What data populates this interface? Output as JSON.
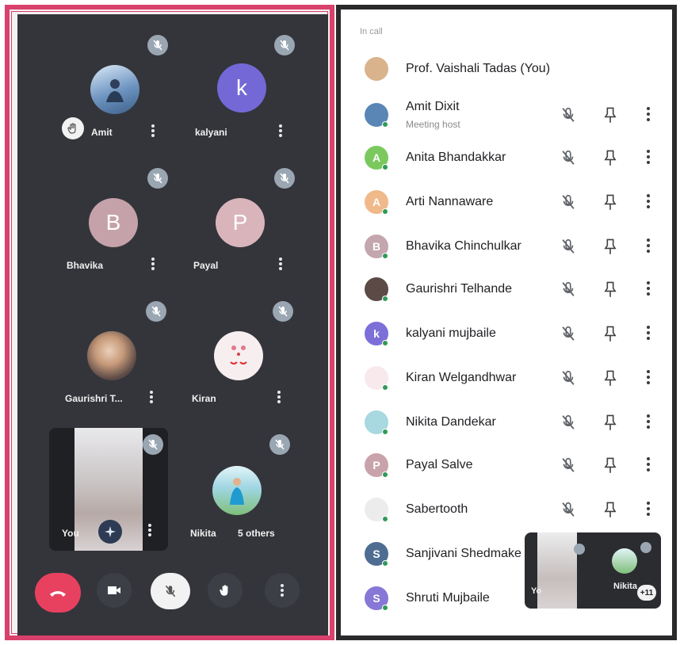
{
  "left_grid": {
    "tiles": [
      {
        "name": "Amit"
      },
      {
        "name": "kalyani",
        "initial": "k"
      },
      {
        "name": "Bhavika",
        "initial": "B"
      },
      {
        "name": "Payal",
        "initial": "P"
      },
      {
        "name": "Gaurishri T..."
      },
      {
        "name": "Kiran"
      },
      {
        "name": "Nikita"
      }
    ],
    "self_label": "You",
    "others_label": "5 others"
  },
  "controls": [
    "end-call",
    "camera",
    "microphone",
    "raise-hand",
    "more-options"
  ],
  "people": {
    "section_label": "In call",
    "rows": [
      {
        "name": "Prof. Vaishali Tadas (You)",
        "avatar_color": "#d9b38c"
      },
      {
        "name": "Amit Dixit",
        "sub": "Meeting host",
        "avatar_color": "#5a86b5"
      },
      {
        "name": "Anita Bhandakkar",
        "initial": "A",
        "avatar_color": "#7bc95e"
      },
      {
        "name": "Arti Nannaware",
        "initial": "A",
        "avatar_color": "#f0b98a"
      },
      {
        "name": "Bhavika Chinchulkar",
        "initial": "B",
        "avatar_color": "#c4a6ae"
      },
      {
        "name": "Gaurishri Telhande",
        "avatar_color": "#5b4a46"
      },
      {
        "name": "kalyani mujbaile",
        "initial": "k",
        "avatar_color": "#7c6fd8"
      },
      {
        "name": "Kiran Welgandhwar",
        "avatar_color": "#f7e9ec"
      },
      {
        "name": "Nikita Dandekar",
        "avatar_color": "#a8d8e0"
      },
      {
        "name": "Payal Salve",
        "initial": "P",
        "avatar_color": "#c9a3ab"
      },
      {
        "name": "Sabertooth",
        "avatar_color": "#ececec"
      },
      {
        "name": "Sanjivani Shedmake",
        "initial": "S",
        "avatar_color": "#4f6d92"
      },
      {
        "name": "Shruti Mujbaile",
        "initial": "S",
        "avatar_color": "#8777d6"
      }
    ]
  },
  "mini_pip": {
    "self_label": "Yo",
    "name": "Nikita",
    "badge": "+11"
  },
  "colors": {
    "end_call": "#e8415f",
    "left_background": "#34353b",
    "frame_pink": "#d9406b",
    "kalyani_avatar": "#7468d6",
    "bhavika_avatar": "#c5a2aa",
    "payal_avatar": "#d9b5bb"
  }
}
